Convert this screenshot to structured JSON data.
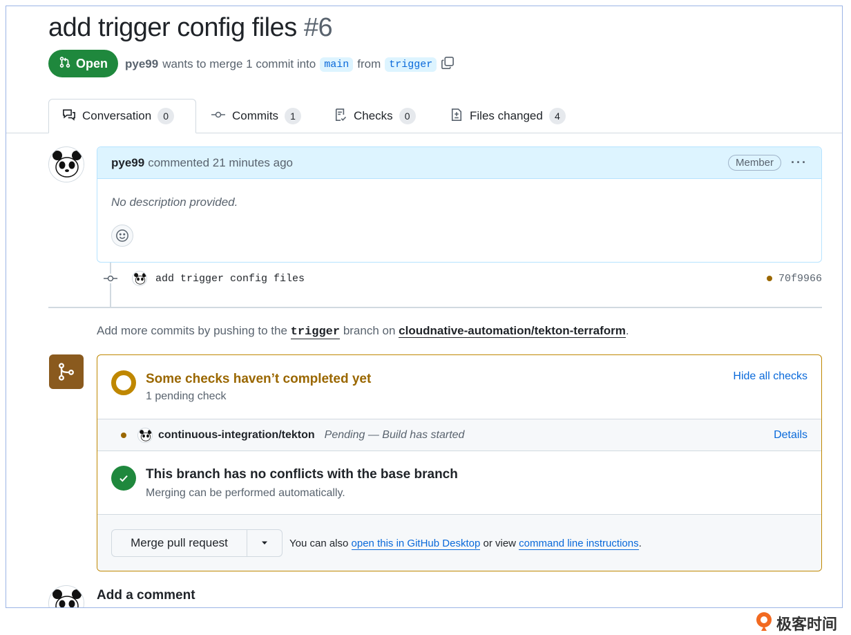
{
  "pr": {
    "title": "add trigger config files",
    "number": "#6",
    "state": "Open",
    "author": "pye99",
    "merge_text": "wants to merge 1 commit into",
    "base_branch": "main",
    "from_text": "from",
    "head_branch": "trigger"
  },
  "tabs": [
    {
      "label": "Conversation",
      "count": "0",
      "icon": "comment-discussion-icon"
    },
    {
      "label": "Commits",
      "count": "1",
      "icon": "git-commit-icon"
    },
    {
      "label": "Checks",
      "count": "0",
      "icon": "checklist-icon"
    },
    {
      "label": "Files changed",
      "count": "4",
      "icon": "file-diff-icon"
    }
  ],
  "comment": {
    "author": "pye99",
    "meta": "commented 21 minutes ago",
    "badge": "Member",
    "body": "No description provided."
  },
  "commit": {
    "message": "add trigger config files",
    "sha": "70f9966"
  },
  "push_hint": {
    "prefix": "Add more commits by pushing to the",
    "branch": "trigger",
    "middle": "branch on",
    "repo": "cloudnative-automation/tekton-terraform",
    "suffix": "."
  },
  "checks": {
    "title": "Some checks haven’t completed yet",
    "subtitle": "1 pending check",
    "hide_link": "Hide all checks",
    "item_name": "continuous-integration/tekton",
    "item_status": "Pending — Build has started",
    "item_link": "Details"
  },
  "conflicts": {
    "title": "This branch has no conflicts with the base branch",
    "subtitle": "Merging can be performed automatically."
  },
  "merge": {
    "button": "Merge pull request",
    "alt_prefix": "You can also",
    "desktop_link": "open this in GitHub Desktop",
    "alt_middle": "or view",
    "cli_link": "command line instructions",
    "alt_suffix": "."
  },
  "add_comment": "Add a comment",
  "watermark": "极客时间",
  "colors": {
    "open_green": "#1f883d",
    "link_blue": "#0969da",
    "pending_amber": "#bf8700",
    "merge_icon_brown": "#8a5a1e"
  }
}
